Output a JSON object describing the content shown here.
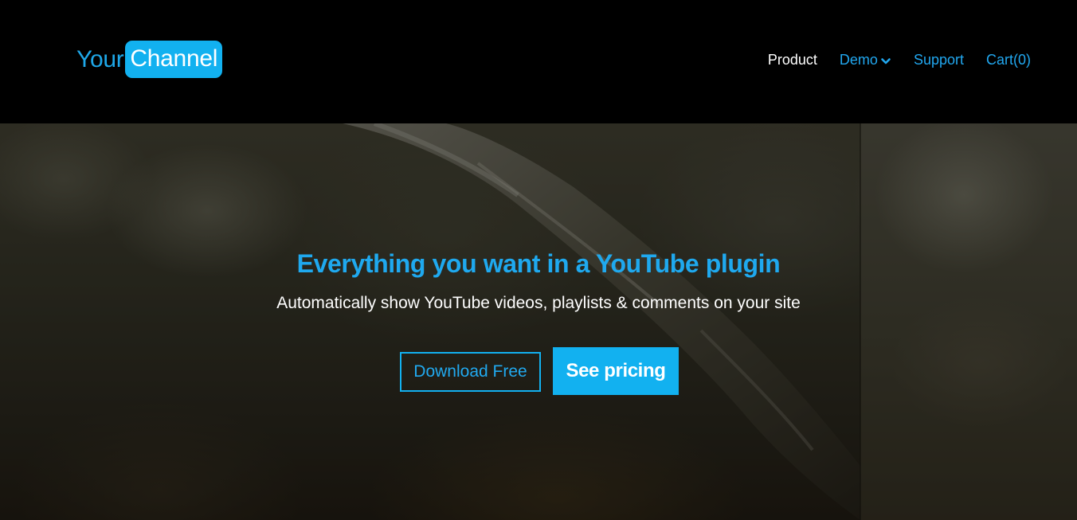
{
  "brand": {
    "logo_part1": "Your",
    "logo_part2": "Channel",
    "accent_color": "#12b1f0"
  },
  "nav": {
    "items": [
      {
        "label": "Product",
        "active": true
      },
      {
        "label": "Demo",
        "has_dropdown": true,
        "icon": "chevron-down-icon"
      },
      {
        "label": "Support"
      },
      {
        "label": "Cart(0)"
      }
    ]
  },
  "hero": {
    "title": "Everything you want in a YouTube plugin",
    "subtitle": "Automatically show YouTube videos, playlists & comments on your site",
    "download_label": "Download Free",
    "pricing_label": "See pricing"
  }
}
